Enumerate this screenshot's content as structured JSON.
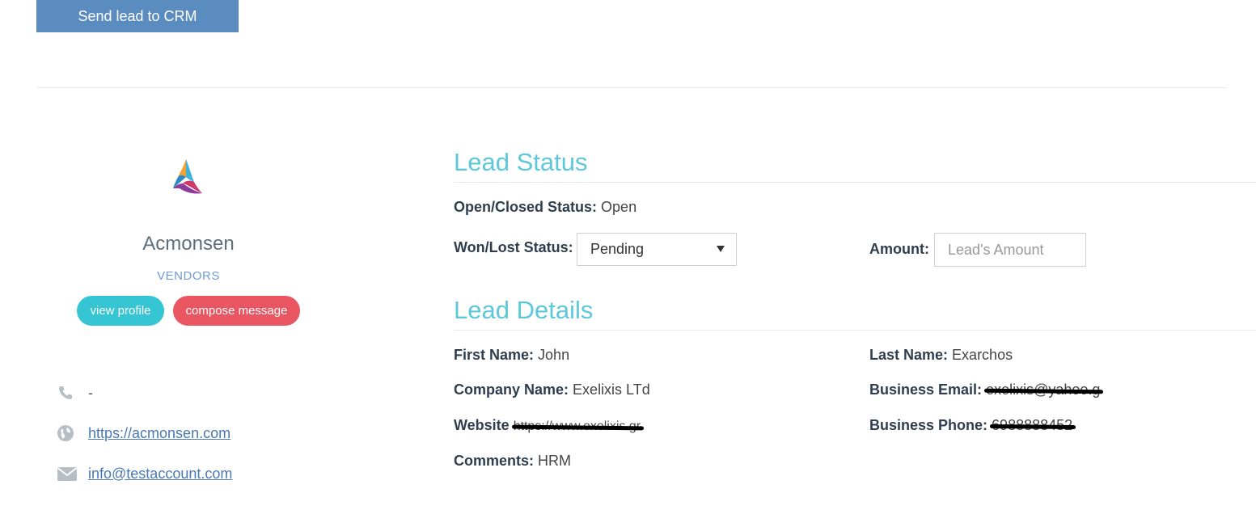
{
  "toolbar": {
    "send_crm_label": "Send lead to CRM"
  },
  "profile": {
    "name": "Acmonsen",
    "category": "VENDORS",
    "view_profile_label": "view profile",
    "compose_message_label": "compose message",
    "phone": "-",
    "website": "https://acmonsen.com",
    "email": "info@testaccount.com"
  },
  "lead_status": {
    "title": "Lead Status",
    "open_closed_label": "Open/Closed Status:",
    "open_closed_value": "Open",
    "won_lost_label": "Won/Lost Status:",
    "won_lost_value": "Pending",
    "amount_label": "Amount:",
    "amount_placeholder": "Lead's Amount"
  },
  "lead_details": {
    "title": "Lead Details",
    "first_name_label": "First Name:",
    "first_name": "John",
    "last_name_label": "Last Name:",
    "last_name": "Exarchos",
    "company_label": "Company Name:",
    "company": "Exelixis LTd",
    "business_email_label": "Business Email:",
    "business_email": "exelixis@yahoo.g",
    "website_label": "Website",
    "website": "https://www.exelixis.gr",
    "business_phone_label": "Business Phone:",
    "business_phone": "6988888452",
    "comments_label": "Comments:",
    "comments": "HRM"
  },
  "colors": {
    "crm_button": "#5b8cc0",
    "section_title": "#5cc8d9",
    "view_profile": "#36c6d3",
    "compose_message": "#e95560"
  },
  "icons": [
    "phone-icon",
    "globe-icon",
    "envelope-icon",
    "company-logo",
    "chevron-down-icon"
  ]
}
